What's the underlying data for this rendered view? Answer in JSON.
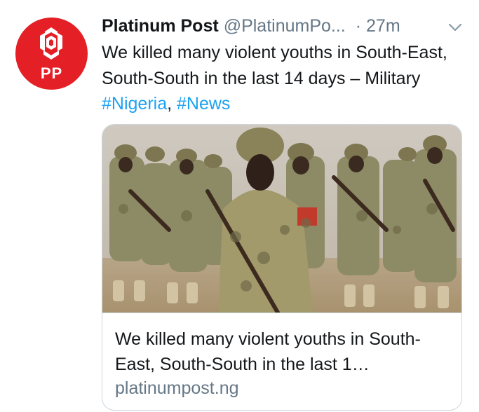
{
  "tweet": {
    "author_name": "Platinum Post",
    "author_handle": "@PlatinumPo...",
    "time": "· 27m",
    "avatar_initials": "PP",
    "text_main": "We killed many violent youths in South-East, South-South in the last 14 days – Military ",
    "hashtags": [
      "#Nigeria",
      "#News"
    ],
    "hashtag_separator": ", ",
    "caret_icon": "chevron-down-icon",
    "accent_color": "#1da1f2",
    "avatar_color": "#e42026"
  },
  "card": {
    "title": "We killed many violent youths in South-East, South-South in the last 1…",
    "domain": "platinumpost.ng",
    "image_subject": "soldiers-photo"
  }
}
